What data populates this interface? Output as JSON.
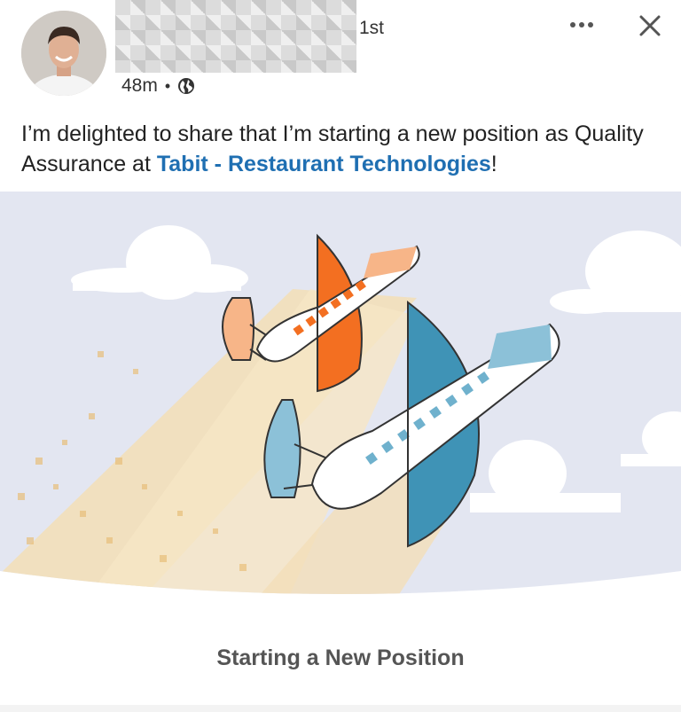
{
  "post": {
    "connection_degree": "1st",
    "time_ago": "48m",
    "separator": "•",
    "visibility_icon": "globe-icon",
    "more_icon": "ellipsis-icon",
    "close_icon": "close-icon",
    "text_prefix": "I’m delighted to share that I’m starting a new position as Quality Assurance at ",
    "company_link": "Tabit - Restaurant Technologies",
    "text_suffix": "!",
    "card_caption": "Starting a New Position"
  },
  "colors": {
    "link": "#1f6fb2",
    "sky": "#e3e6f1",
    "beam": "#f2dfb9",
    "orange": "#f36f21",
    "blue": "#3f93b6"
  }
}
